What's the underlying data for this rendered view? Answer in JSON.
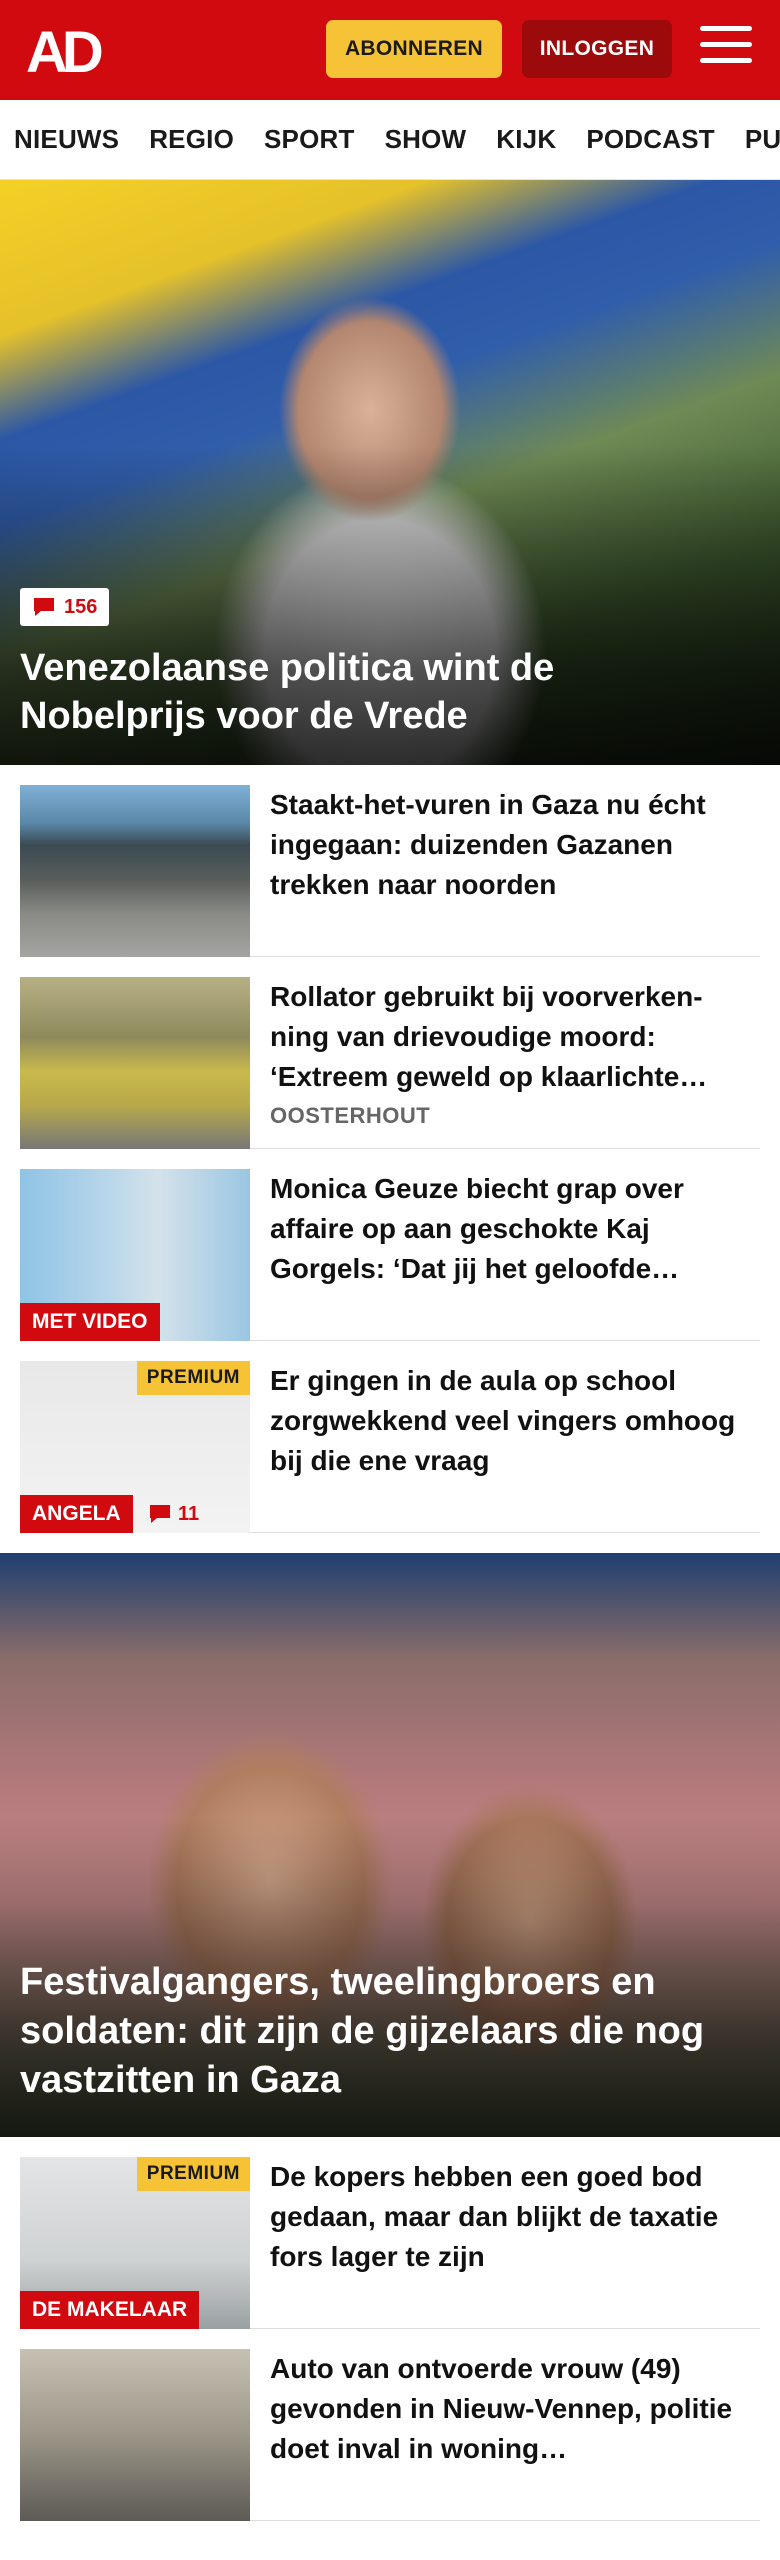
{
  "header": {
    "logo_text": "AD",
    "subscribe_label": "ABONNEREN",
    "login_label": "INLOGGEN",
    "brand_color": "#d10a10",
    "subscribe_color": "#f6c236"
  },
  "nav": {
    "items": [
      "NIEUWS",
      "REGIO",
      "SPORT",
      "SHOW",
      "KIJK",
      "PODCAST",
      "PUZZ"
    ]
  },
  "hero": {
    "comment_count": "156",
    "title": "Venezolaanse politica wint de Nobelprijs voor de Vrede"
  },
  "articles": [
    {
      "title": "Staakt-het-vuren in Gaza nu écht ingegaan: duizenden Gazanen trekken naar noorden"
    },
    {
      "title": "Rollator gebruikt bij voorverken­ning van drievoudige moord: ‘Extreem geweld op klaarlichte…",
      "location": "OOSTERHOUT"
    },
    {
      "title": "Monica Geuze biecht grap over affaire op aan geschokte Kaj Gorgels: ‘Dat jij het geloofde…",
      "tag": "MET VIDEO"
    },
    {
      "title": "Er gingen in de aula op school zorgwekkend veel vingers omhoog bij die ene vraag",
      "tag": "ANGELA",
      "premium": "PREMIUM",
      "comment_count": "11"
    }
  ],
  "hero2": {
    "title": "Festivalgangers, tweelingbroers en soldaten: dit zijn de gijzelaars die nog vastzitten in Gaza"
  },
  "articles2": [
    {
      "title": "De kopers hebben een goed bod gedaan, maar dan blijkt de taxatie fors lager te zijn",
      "tag": "DE MAKELAAR",
      "premium": "PREMIUM"
    },
    {
      "title": "Auto van ontvoerde vrouw (49) gevonden in Nieuw-Vennep, politie doet inval in woning…"
    }
  ]
}
